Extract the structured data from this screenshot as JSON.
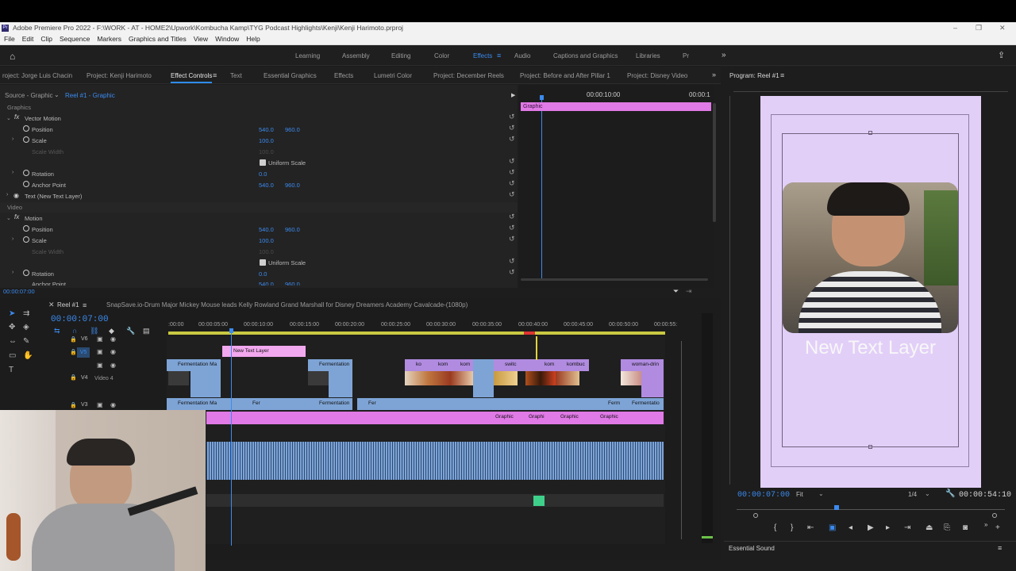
{
  "window": {
    "title": "Adobe Premiere Pro 2022 - F:\\WORK - AT - HOME2\\Upwork\\Kombucha Kamp\\TYG Podcast Highlights\\Kenji\\Kenji Harimoto.prproj"
  },
  "menu": [
    "File",
    "Edit",
    "Clip",
    "Sequence",
    "Markers",
    "Graphics and Titles",
    "View",
    "Window",
    "Help"
  ],
  "workspaces": [
    "Learning",
    "Assembly",
    "Editing",
    "Color",
    "Effects",
    "Audio",
    "Captions and Graphics",
    "Libraries",
    "Pr"
  ],
  "active_workspace": "Effects",
  "panel_tabs": [
    "roject: Jorge Luis Chacin",
    "Project: Kenji Harimoto",
    "Effect Controls",
    "Text",
    "Essential Graphics",
    "Effects",
    "Lumetri Color",
    "Project: December Reels",
    "Project: Before and After Pillar 1",
    "Project: Disney Video"
  ],
  "effect_controls": {
    "source": "Source - Graphic",
    "reel": "Reel #1 - Graphic",
    "mini_timecode": "00:00:10:00",
    "mini_timecode2": "00:00:1",
    "graphic_label": "Graphic",
    "sections": {
      "graphics": "Graphics",
      "video": "Video"
    },
    "vector_motion": "Vector Motion",
    "motion": "Motion",
    "text_layer": "Text (New Text Layer)",
    "props": {
      "position": "Position",
      "scale": "Scale",
      "scale_width": "Scale Width",
      "uniform_scale": "Uniform Scale",
      "rotation": "Rotation",
      "anchor_point": "Anchor Point"
    },
    "values": {
      "pos_x": "540.0",
      "pos_y": "960.0",
      "scale": "100.0",
      "scale_width": "100.0",
      "rotation": "0.0",
      "anchor_x": "540.0",
      "anchor_y": "960.0",
      "pos2_x": "540.0",
      "pos2_y": "960.0",
      "scale2": "100.0",
      "scale_width2": "100.0",
      "rotation2": "0.0",
      "anchor2_x": "540.0",
      "anchor2_y": "960.0"
    },
    "timecode": "00:00:07:00"
  },
  "timeline": {
    "tab": "Reel #1",
    "tab2": "SnapSave.io-Drum Major Mickey Mouse leads Kelly Rowland Grand Marshall for Disney Dreamers Academy Cavalcade-(1080p)",
    "timecode": "00:00:07:00",
    "ruler": [
      ":00:00",
      "00:00:05:00",
      "00:00:10:00",
      "00:00:15:00",
      "00:00:20:00",
      "00:00:25:00",
      "00:00:30:00",
      "00:00:35:00",
      "00:00:40:00",
      "00:00:45:00",
      "00:00:50:00",
      "00:00:55:"
    ],
    "tracks": {
      "v6": "V6",
      "v5": "V5",
      "v4": "V4",
      "video4": "Video 4",
      "v3": "V3"
    },
    "clips": {
      "new_text_layer": "New Text Layer",
      "fermentation_ma": "Fermentation Ma",
      "fermentation": "Fermentation",
      "ko": "ko",
      "kom": "kom",
      "switc": "switc",
      "kombuc": "kombuc",
      "woman_drin": "woman-drin",
      "fer": "Fer",
      "ferm": "Ferm",
      "fermentatio": "Fermentatio",
      "graphic": "Graphic",
      "graphi": "Graphi"
    }
  },
  "program": {
    "title": "Program: Reel #1",
    "overlay_text": "New Text Layer",
    "timecode": "00:00:07:00",
    "fit": "Fit",
    "ratio": "1/4",
    "duration": "00:00:54:10",
    "essential_sound": "Essential Sound"
  }
}
